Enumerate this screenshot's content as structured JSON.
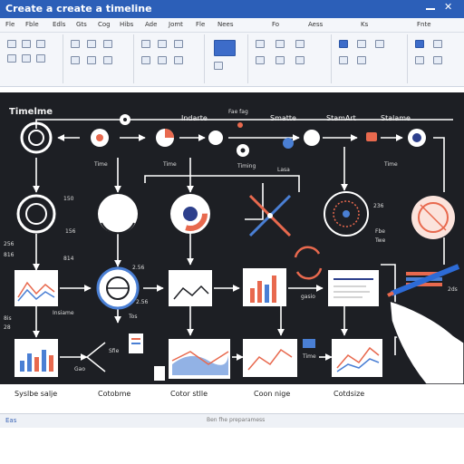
{
  "window": {
    "title": "Create a create a timeline"
  },
  "ribbon": {
    "tabs": [
      "Fle",
      "Fble",
      "Edls",
      "Gts",
      "Cog",
      "Hibs",
      "Ade",
      "Jomt",
      "Fle",
      "Nees",
      "Fo",
      "Aess",
      "Ks",
      "Fnte"
    ]
  },
  "canvas": {
    "heading": "Timelme",
    "top_labels": [
      "Indarte",
      "Smatte",
      "StamArt",
      "Stalame"
    ],
    "labels": {
      "time1": "Time",
      "time2": "Time",
      "timing": "Timing",
      "lasa": "Lasa",
      "time3": "Time",
      "fag": "Fae fag",
      "n150": "150",
      "n156": "156",
      "n256": "256",
      "n816": "816",
      "n814": "814",
      "fbe": "Fbe",
      "twe": "Twe",
      "n236": "236",
      "n256b": "2.56",
      "n2ds": "2ds",
      "n256c": "2.56",
      "gasio": "gasio",
      "insiame": "Insiame",
      "n8s": "8is",
      "n28": "28",
      "tos": "Tos",
      "gao": "Gao",
      "sfie": "Sfie",
      "timesm": "Time"
    },
    "bottom_labels": [
      "Syslbe salje",
      "Cotobme",
      "Cotor stlle",
      "Coon nige",
      "Cotdsize"
    ]
  },
  "status": {
    "left": "Eas",
    "mid": "Ben fhe preparamess"
  },
  "colors": {
    "accent": "#2c5fb8",
    "canvas": "#1d1f24",
    "highlight": "#e8694e"
  }
}
